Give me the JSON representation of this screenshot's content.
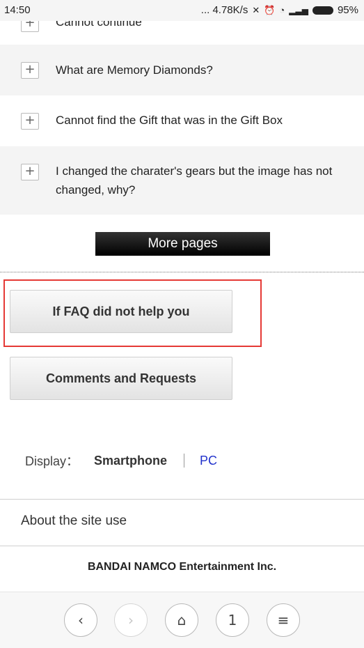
{
  "status_bar": {
    "time": "14:50",
    "network_speed": "... 4.78K/s",
    "battery": "95%"
  },
  "faq": {
    "items": [
      {
        "label": "Cannot continue",
        "expand_icon": "plus-icon"
      },
      {
        "label": "What are Memory Diamonds?",
        "expand_icon": "plus-icon"
      },
      {
        "label": "Cannot find the Gift that was in the Gift Box",
        "expand_icon": "plus-icon"
      },
      {
        "label": "I changed the charater's gears but the image has not changed, why?",
        "expand_icon": "plus-icon"
      }
    ],
    "more_pages_label": "More pages"
  },
  "help": {
    "faq_not_help_label": "If FAQ did not help you",
    "comments_label": "Comments and Requests",
    "highlight_color": "#e53935"
  },
  "display_switch": {
    "label": "Display：",
    "smartphone": "Smartphone",
    "pc": "PC",
    "link_color": "#2233cc"
  },
  "footer": {
    "about": "About the site use",
    "company": "BANDAI NAMCO Entertainment Inc."
  },
  "browser_nav": {
    "back_icon": "chevron-left-icon",
    "forward_icon": "chevron-right-icon",
    "home_icon": "home-icon",
    "tabs_count": "1",
    "menu_icon": "hamburger-menu-icon"
  }
}
